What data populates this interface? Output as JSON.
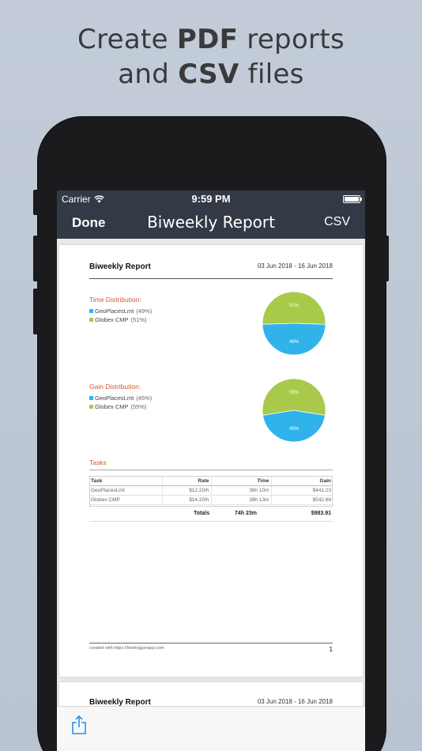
{
  "headline": {
    "line1_pre": "Create ",
    "line1_bold": "PDF",
    "line1_post": " reports",
    "line2_pre": "and ",
    "line2_bold": "CSV",
    "line2_post": " files"
  },
  "status_bar": {
    "carrier": "Carrier",
    "time": "9:59 PM",
    "wifi_icon": "wifi-icon",
    "battery_icon": "battery-icon"
  },
  "nav": {
    "done_label": "Done",
    "title": "Biweekly Report",
    "csv_label": "CSV"
  },
  "report": {
    "title": "Biweekly Report",
    "date_range": "03 Jun 2018 - 16 Jun 2018",
    "time_distribution": {
      "heading": "Time Distribution:",
      "items": [
        {
          "name": "GeoPlacesLmt",
          "pct_label": "(49%)",
          "pie_label": "49%",
          "pct": 49,
          "color": "#2fb3ea"
        },
        {
          "name": "Globex CMP",
          "pct_label": "(51%)",
          "pie_label": "51%",
          "pct": 51,
          "color": "#a9c94a"
        }
      ]
    },
    "gain_distribution": {
      "heading": "Gain Distribution:",
      "items": [
        {
          "name": "GeoPlacesLmt",
          "pct_label": "(45%)",
          "pie_label": "45%",
          "pct": 45,
          "color": "#2fb3ea"
        },
        {
          "name": "Globex CMP",
          "pct_label": "(55%)",
          "pie_label": "55%",
          "pct": 55,
          "color": "#a9c94a"
        }
      ]
    },
    "tasks": {
      "heading": "Tasks",
      "columns": [
        "Task",
        "Rate",
        "Time",
        "Gain"
      ],
      "rows": [
        [
          "GeoPlacesLmt",
          "$12.20/h",
          "36h 10m",
          "$441.23"
        ],
        [
          "Globex CMP",
          "$14.20/h",
          "38h 13m",
          "$542.68"
        ]
      ],
      "totals_label": "Totals",
      "totals_time": "74h 23m",
      "totals_gain": "$983.91"
    },
    "footer_note": "created with https://timeloggerapp.com",
    "page_number": "1"
  },
  "page2": {
    "title": "Biweekly Report",
    "date_range": "03 Jun 2018 - 16 Jun 2018"
  },
  "toolbar": {
    "share_icon": "share-icon"
  },
  "colors": {
    "accent": "#d5572f",
    "navbar": "#333a45",
    "geoplaces": "#2fb3ea",
    "globex": "#a9c94a"
  }
}
